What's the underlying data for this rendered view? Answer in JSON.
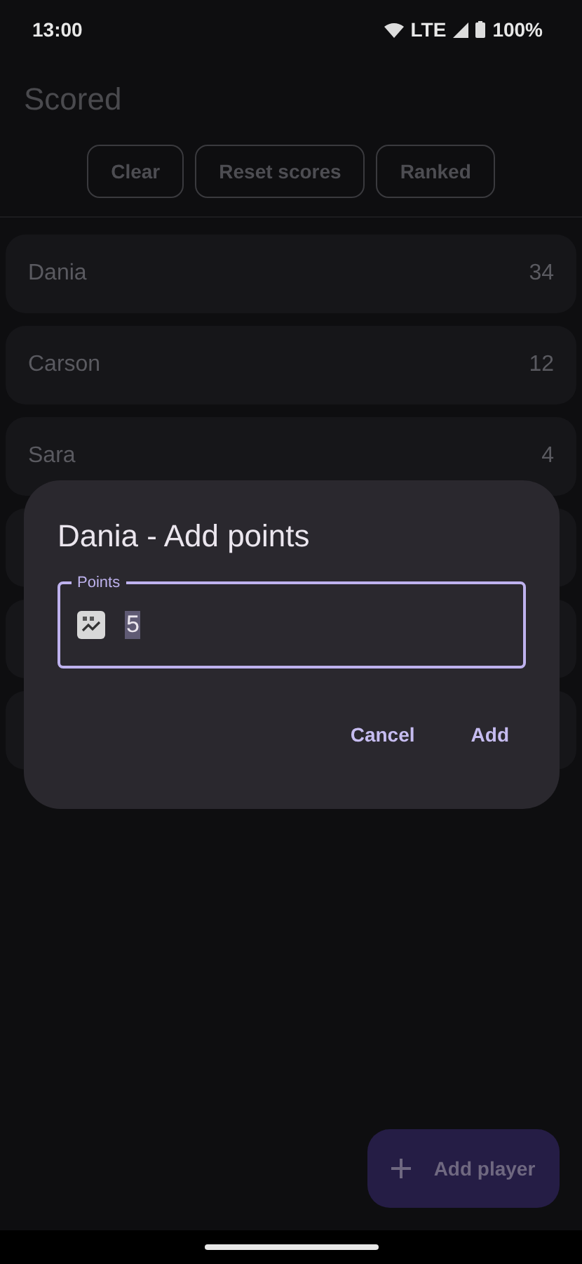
{
  "status_bar": {
    "time": "13:00",
    "network": "LTE",
    "battery": "100%"
  },
  "app_title": "Scored",
  "actions": [
    "Clear",
    "Reset scores",
    "Ranked"
  ],
  "players": [
    {
      "name": "Dania",
      "score": "34"
    },
    {
      "name": "Carson",
      "score": "12"
    },
    {
      "name": "Sara",
      "score": "4"
    }
  ],
  "covered_rows": [
    {
      "kind": "covered"
    },
    {
      "kind": "covered"
    },
    {
      "kind": "covered"
    }
  ],
  "dialog": {
    "title": "Dania - Add points",
    "field": {
      "label": "Points",
      "value": "5"
    },
    "buttons": [
      "Cancel",
      "Add"
    ]
  },
  "fab": {
    "label": "Add player"
  }
}
